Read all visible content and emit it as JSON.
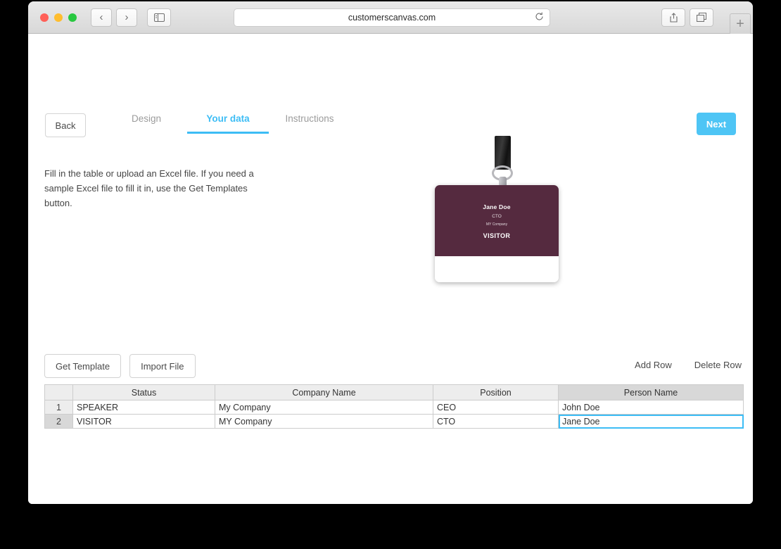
{
  "browser": {
    "url": "customerscanvas.com",
    "reload_icon": "reload-icon",
    "back_icon": "‹",
    "forward_icon": "›",
    "sidebar_icon": "sidebar-icon",
    "share_icon": "share-icon",
    "tabs_icon": "tabs-icon",
    "newtab_label": "+"
  },
  "nav": {
    "back_label": "Back",
    "next_label": "Next",
    "tabs": [
      {
        "label": "Design",
        "active": false
      },
      {
        "label": "Your data",
        "active": true
      },
      {
        "label": "Instructions",
        "active": false
      }
    ]
  },
  "main": {
    "intro": "Fill in the table or upload an Excel file. If you need a sample Excel file to fill it in, use the Get Templates button."
  },
  "badge": {
    "name": "Jane Doe",
    "position": "CTO",
    "company": "MY Company",
    "status": "VISITOR",
    "bg_color": "#552a3f"
  },
  "toolbar": {
    "get_template_label": "Get Template",
    "import_file_label": "Import File",
    "add_row_label": "Add Row",
    "delete_row_label": "Delete Row"
  },
  "table": {
    "columns": [
      "Status",
      "Company Name",
      "Position",
      "Person Name"
    ],
    "selected_column": "Person Name",
    "rows": [
      {
        "num": "1",
        "status": "SPEAKER",
        "company": "My Company",
        "position": "CEO",
        "person": "John Doe"
      },
      {
        "num": "2",
        "status": "VISITOR",
        "company": "MY Company",
        "position": "CTO",
        "person": "Jane Doe"
      }
    ],
    "selected_cell": {
      "row": 2,
      "column": "Person Name"
    }
  },
  "colors": {
    "accent": "#3dbdf5",
    "next_button": "#4ec5f5",
    "badge": "#552a3f"
  }
}
